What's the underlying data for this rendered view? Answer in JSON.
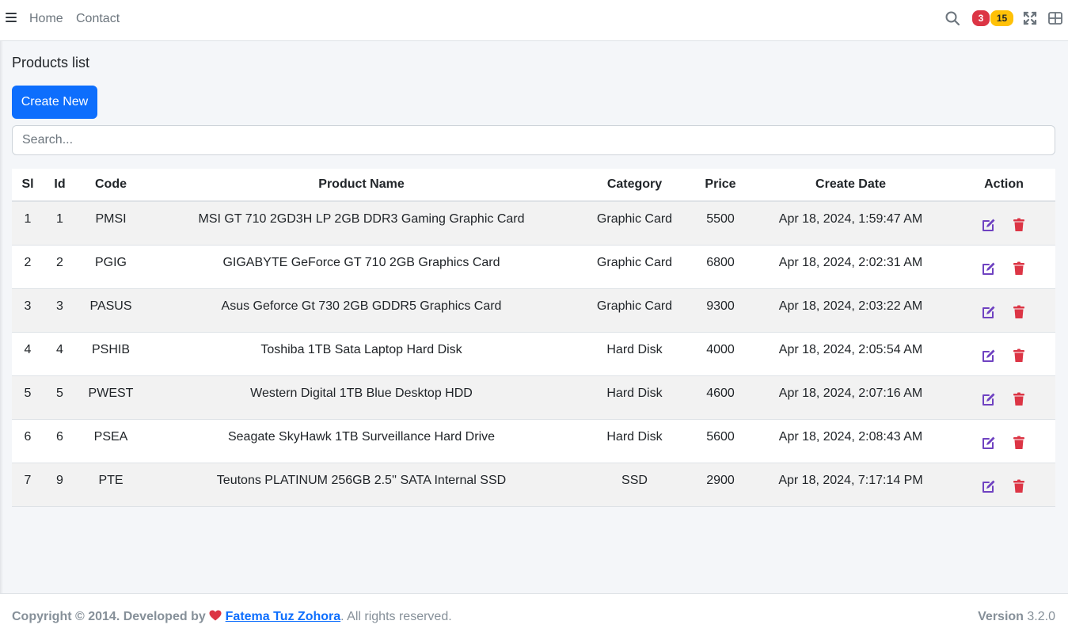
{
  "nav": {
    "home_label": "Home",
    "contact_label": "Contact",
    "messages_badge": "3",
    "notifications_badge": "15"
  },
  "page": {
    "title": "Products list",
    "create_label": "Create New",
    "search_placeholder": "Search..."
  },
  "table": {
    "headers": {
      "si": "Sl",
      "id": "Id",
      "code": "Code",
      "name": "Product Name",
      "category": "Category",
      "price": "Price",
      "date": "Create Date",
      "action": "Action"
    },
    "rows": [
      {
        "si": "1",
        "id": "1",
        "code": "PMSI",
        "name": "MSI GT 710 2GD3H LP 2GB DDR3 Gaming Graphic Card",
        "category": "Graphic Card",
        "price": "5500",
        "date": "Apr 18, 2024, 1:59:47 AM"
      },
      {
        "si": "2",
        "id": "2",
        "code": "PGIG",
        "name": "GIGABYTE GeForce GT 710 2GB Graphics Card",
        "category": "Graphic Card",
        "price": "6800",
        "date": "Apr 18, 2024, 2:02:31 AM"
      },
      {
        "si": "3",
        "id": "3",
        "code": "PASUS",
        "name": "Asus Geforce Gt 730 2GB GDDR5 Graphics Card",
        "category": "Graphic Card",
        "price": "9300",
        "date": "Apr 18, 2024, 2:03:22 AM"
      },
      {
        "si": "4",
        "id": "4",
        "code": "PSHIB",
        "name": "Toshiba 1TB Sata Laptop Hard Disk",
        "category": "Hard Disk",
        "price": "4000",
        "date": "Apr 18, 2024, 2:05:54 AM"
      },
      {
        "si": "5",
        "id": "5",
        "code": "PWEST",
        "name": "Western Digital 1TB Blue Desktop HDD",
        "category": "Hard Disk",
        "price": "4600",
        "date": "Apr 18, 2024, 2:07:16 AM"
      },
      {
        "si": "6",
        "id": "6",
        "code": "PSEA",
        "name": "Seagate SkyHawk 1TB Surveillance Hard Drive",
        "category": "Hard Disk",
        "price": "5600",
        "date": "Apr 18, 2024, 2:08:43 AM"
      },
      {
        "si": "7",
        "id": "9",
        "code": "PTE",
        "name": "Teutons PLATINUM 256GB 2.5'' SATA Internal SSD",
        "category": "SSD",
        "price": "2900",
        "date": "Apr 18, 2024, 7:17:14 PM"
      }
    ]
  },
  "footer": {
    "copyright": "Copyright © 2014. Developed by",
    "author": "Fatema Tuz Zohora",
    "rights": ". All rights reserved.",
    "version_label": "Version",
    "version_value": "3.2.0"
  },
  "icons": {
    "menu": "hamburger-icon",
    "search": "search-icon",
    "fullscreen": "expand-icon",
    "layout": "grid-icon",
    "edit": "edit-icon",
    "delete": "trash-icon",
    "heart": "heart-icon"
  },
  "colors": {
    "primary": "#0d6efd",
    "danger": "#dc3545",
    "warning": "#ffc107",
    "edit_icon": "#6f42c1"
  }
}
